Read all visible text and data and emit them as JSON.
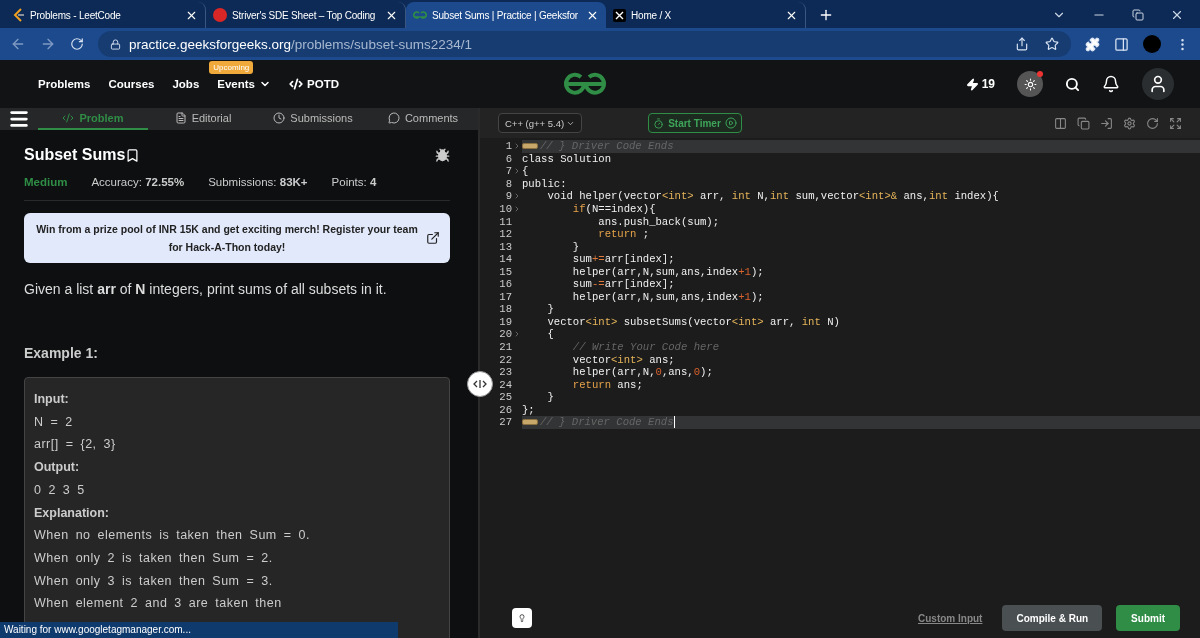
{
  "browser": {
    "tabs": [
      {
        "title": "Problems - LeetCode",
        "selected": false
      },
      {
        "title": "Striver's SDE Sheet – Top Coding",
        "selected": false
      },
      {
        "title": "Subset Sums | Practice | Geeksfor",
        "selected": true
      },
      {
        "title": "Home / X",
        "selected": false
      }
    ],
    "url_host": "practice.geeksforgeeks.org",
    "url_path": "/problems/subset-sums2234/1"
  },
  "site_nav": {
    "links": [
      {
        "label": "Problems",
        "kind": "plain"
      },
      {
        "label": "Courses",
        "kind": "plain"
      },
      {
        "label": "Jobs",
        "kind": "plain"
      },
      {
        "label": "Events",
        "kind": "dropdown",
        "badge": "Upcoming"
      },
      {
        "label": "POTD",
        "kind": "code"
      }
    ],
    "streak": "19"
  },
  "problem_tabs": [
    {
      "label": "Problem",
      "selected": true
    },
    {
      "label": "Editorial",
      "selected": false
    },
    {
      "label": "Submissions",
      "selected": false
    },
    {
      "label": "Comments",
      "selected": false
    }
  ],
  "problem": {
    "title": "Subset Sums",
    "difficulty": "Medium",
    "stats": [
      "Accuracy: **72.55%**",
      "Submissions: **83K+**",
      "Points: **4**"
    ],
    "banner": "Win from a prize pool of INR 15K and get exciting merch! Register your team for Hack-A-Thon today!",
    "description": "Given a list **arr** of **N** integers, print sums of all subsets in it.",
    "example_title": "Example 1:",
    "example_lines": [
      {
        "kind": "heading",
        "text": "Input:"
      },
      {
        "kind": "text",
        "text": "N = 2"
      },
      {
        "kind": "text",
        "text": "arr[] = {2, 3}"
      },
      {
        "kind": "heading",
        "text": "Output:"
      },
      {
        "kind": "text",
        "text": "0 2 3 5"
      },
      {
        "kind": "heading",
        "text": "Explanation:"
      },
      {
        "kind": "text",
        "text": "When no elements is taken then Sum = 0."
      },
      {
        "kind": "text",
        "text": "When only 2 is taken then Sum = 2."
      },
      {
        "kind": "text",
        "text": "When only 3 is taken then Sum = 3."
      },
      {
        "kind": "text",
        "text": "When element 2 and 3 are taken then"
      }
    ]
  },
  "editor": {
    "language": "C++ (g++ 5.4)",
    "timer": "Start Timer",
    "lines": [
      {
        "number": "1",
        "foldable": true,
        "folded": true,
        "highlighted": true,
        "tokens": [
          {
            "kind": "comment",
            "text": "// } Driver Code Ends"
          }
        ]
      },
      {
        "number": "6",
        "foldable": false,
        "folded": false,
        "highlighted": false,
        "tokens": [
          {
            "kind": "plain",
            "text": "class Solution"
          }
        ]
      },
      {
        "number": "7",
        "foldable": true,
        "folded": false,
        "highlighted": false,
        "tokens": [
          {
            "kind": "plain",
            "text": "{"
          }
        ]
      },
      {
        "number": "8",
        "foldable": false,
        "folded": false,
        "highlighted": false,
        "tokens": [
          {
            "kind": "plain",
            "text": "public:"
          }
        ]
      },
      {
        "number": "9",
        "foldable": true,
        "folded": false,
        "highlighted": false,
        "tokens": [
          {
            "kind": "plain",
            "text": "    void helper(vector"
          },
          {
            "kind": "type",
            "text": "<int>"
          },
          {
            "kind": "plain",
            "text": " arr, "
          },
          {
            "kind": "type",
            "text": "int"
          },
          {
            "kind": "plain",
            "text": " N,"
          },
          {
            "kind": "type",
            "text": "int"
          },
          {
            "kind": "plain",
            "text": " sum,vector"
          },
          {
            "kind": "type",
            "text": "<int>&"
          },
          {
            "kind": "plain",
            "text": " ans,"
          },
          {
            "kind": "type",
            "text": "int"
          },
          {
            "kind": "plain",
            "text": " index){"
          }
        ]
      },
      {
        "number": "10",
        "foldable": true,
        "folded": false,
        "highlighted": false,
        "tokens": [
          {
            "kind": "keyword",
            "text": "        if"
          },
          {
            "kind": "plain",
            "text": "(N==index){"
          }
        ]
      },
      {
        "number": "11",
        "foldable": false,
        "folded": false,
        "highlighted": false,
        "tokens": [
          {
            "kind": "plain",
            "text": "            ans.push_back(sum);"
          }
        ]
      },
      {
        "number": "12",
        "foldable": false,
        "folded": false,
        "highlighted": false,
        "tokens": [
          {
            "kind": "keyword",
            "text": "            return"
          },
          {
            "kind": "plain",
            "text": " ;"
          }
        ]
      },
      {
        "number": "13",
        "foldable": false,
        "folded": false,
        "highlighted": false,
        "tokens": [
          {
            "kind": "plain",
            "text": "        }"
          }
        ]
      },
      {
        "number": "14",
        "foldable": false,
        "folded": false,
        "highlighted": false,
        "tokens": [
          {
            "kind": "plain",
            "text": "        sum"
          },
          {
            "kind": "operator",
            "text": "+="
          },
          {
            "kind": "plain",
            "text": "arr[index];"
          }
        ]
      },
      {
        "number": "15",
        "foldable": false,
        "folded": false,
        "highlighted": false,
        "tokens": [
          {
            "kind": "plain",
            "text": "        helper(arr,N,sum,ans,index"
          },
          {
            "kind": "number",
            "text": "+1"
          },
          {
            "kind": "plain",
            "text": ");"
          }
        ]
      },
      {
        "number": "16",
        "foldable": false,
        "folded": false,
        "highlighted": false,
        "tokens": [
          {
            "kind": "plain",
            "text": "        sum"
          },
          {
            "kind": "operator",
            "text": "-="
          },
          {
            "kind": "plain",
            "text": "arr[index];"
          }
        ]
      },
      {
        "number": "17",
        "foldable": false,
        "folded": false,
        "highlighted": false,
        "tokens": [
          {
            "kind": "plain",
            "text": "        helper(arr,N,sum,ans,index"
          },
          {
            "kind": "number",
            "text": "+1"
          },
          {
            "kind": "plain",
            "text": ");"
          }
        ]
      },
      {
        "number": "18",
        "foldable": false,
        "folded": false,
        "highlighted": false,
        "tokens": [
          {
            "kind": "plain",
            "text": "    }"
          }
        ]
      },
      {
        "number": "19",
        "foldable": false,
        "folded": false,
        "highlighted": false,
        "tokens": [
          {
            "kind": "plain",
            "text": "    vector"
          },
          {
            "kind": "type",
            "text": "<int>"
          },
          {
            "kind": "plain",
            "text": " subsetSums(vector"
          },
          {
            "kind": "type",
            "text": "<int>"
          },
          {
            "kind": "plain",
            "text": " arr, "
          },
          {
            "kind": "type",
            "text": "int"
          },
          {
            "kind": "plain",
            "text": " N)"
          }
        ]
      },
      {
        "number": "20",
        "foldable": true,
        "folded": false,
        "highlighted": false,
        "tokens": [
          {
            "kind": "plain",
            "text": "    {"
          }
        ]
      },
      {
        "number": "21",
        "foldable": false,
        "folded": false,
        "highlighted": false,
        "tokens": [
          {
            "kind": "comment",
            "text": "        // Write Your Code here"
          }
        ]
      },
      {
        "number": "22",
        "foldable": false,
        "folded": false,
        "highlighted": false,
        "tokens": [
          {
            "kind": "plain",
            "text": "        vector"
          },
          {
            "kind": "type",
            "text": "<int>"
          },
          {
            "kind": "plain",
            "text": " ans;"
          }
        ]
      },
      {
        "number": "23",
        "foldable": false,
        "folded": false,
        "highlighted": false,
        "tokens": [
          {
            "kind": "plain",
            "text": "        helper(arr,N,"
          },
          {
            "kind": "number",
            "text": "0"
          },
          {
            "kind": "plain",
            "text": ",ans,"
          },
          {
            "kind": "number",
            "text": "0"
          },
          {
            "kind": "plain",
            "text": ");"
          }
        ]
      },
      {
        "number": "24",
        "foldable": false,
        "folded": false,
        "highlighted": false,
        "tokens": [
          {
            "kind": "keyword",
            "text": "        return"
          },
          {
            "kind": "plain",
            "text": " ans;"
          }
        ]
      },
      {
        "number": "25",
        "foldable": false,
        "folded": false,
        "highlighted": false,
        "tokens": [
          {
            "kind": "plain",
            "text": "    }"
          }
        ]
      },
      {
        "number": "26",
        "foldable": false,
        "folded": false,
        "highlighted": false,
        "tokens": [
          {
            "kind": "plain",
            "text": "};"
          }
        ]
      },
      {
        "number": "27",
        "foldable": false,
        "folded": true,
        "highlighted": true,
        "tokens": [
          {
            "kind": "comment",
            "text": "// } Driver Code Ends"
          }
        ]
      }
    ]
  },
  "footer": {
    "custom_input": "Custom Input",
    "compile": "Compile & Run",
    "submit": "Submit"
  },
  "status_bar": "Waiting for www.googletagmanager.com..."
}
